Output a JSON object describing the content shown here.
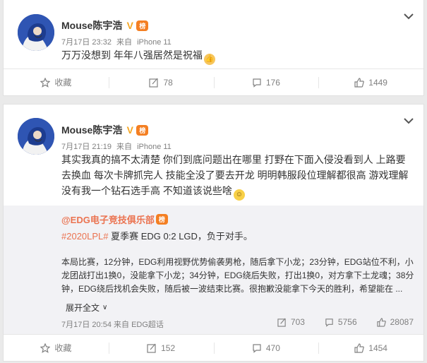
{
  "posts": [
    {
      "username": "Mouse陈宇浩",
      "verified_glyph": "V",
      "rank_badge": "榜",
      "time": "7月17日 23:32",
      "source_prefix": "来自",
      "source": "iPhone 11",
      "text": "万万没想到 年年八强居然是祝福",
      "actions": {
        "favorite": "收藏",
        "repost": "78",
        "comment": "176",
        "like": "1449"
      }
    },
    {
      "username": "Mouse陈宇浩",
      "verified_glyph": "V",
      "rank_badge": "榜",
      "time": "7月17日 21:19",
      "source_prefix": "来自",
      "source": "iPhone 11",
      "text": "其实我真的搞不太清楚 你们到底问题出在哪里 打野在下面入侵没看到人 上路要去换血 每次卡牌抓完人 技能全没了要去开龙 明明韩服段位理解都很高 游戏理解没有我一个钻石选手高 不知道该说些啥",
      "repost": {
        "author": "@EDG电子竞技俱乐部",
        "hashtag": "#2020LPL#",
        "headline": " 夏季赛 EDG 0:2 LGD，负于对手。",
        "body": "本局比赛，12分钟，EDG利用视野优势偷袭男枪，随后拿下小龙；23分钟，EDG站位不利，小龙团战打出1换0，没能拿下小龙；34分钟，EDG绕后失败，打出1换0，对方拿下土龙魂；38分钟，EDG绕后找机会失败，随后被一波结束比赛。很抱歉没能拿下今天的胜利，希望能在 ...",
        "expand": "展开全文",
        "time": "7月17日 20:54",
        "source_prefix": "来自",
        "source": "EDG超话",
        "stats": {
          "repost": "703",
          "comment": "5756",
          "like": "28087"
        }
      },
      "actions": {
        "favorite": "收藏",
        "repost": "152",
        "comment": "470",
        "like": "1454"
      }
    }
  ],
  "colors": {
    "link": "#eb7350",
    "muted": "#808080",
    "badge": "#f47f22",
    "verified": "#f5a623"
  }
}
